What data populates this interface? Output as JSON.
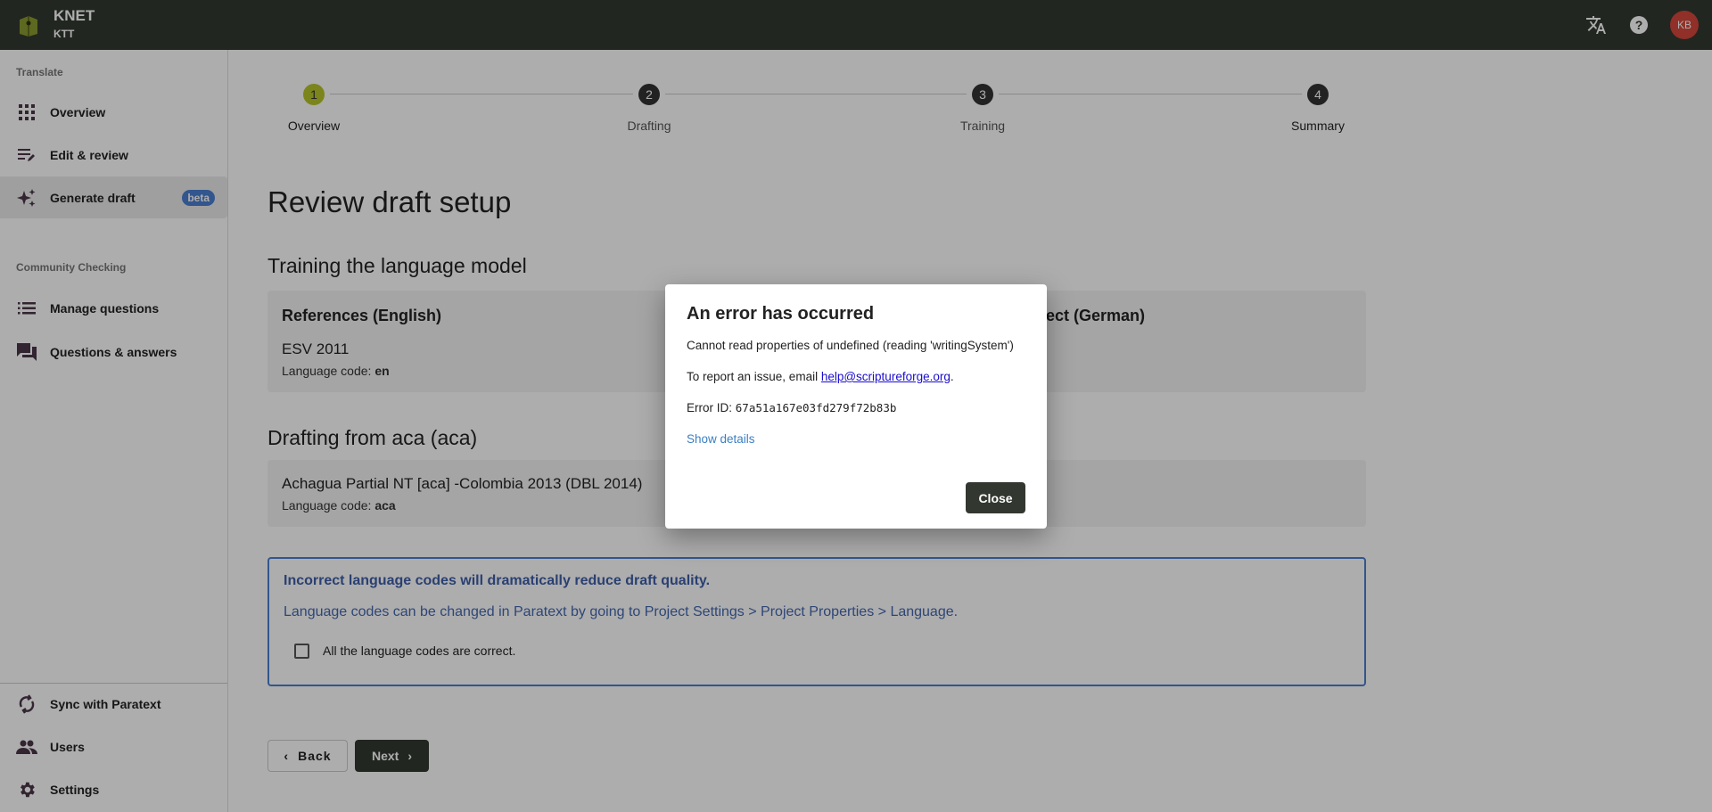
{
  "topbar": {
    "title": "KNET",
    "subtitle": "KTT",
    "avatar_initials": "KB",
    "icons": [
      "translate-icon",
      "help-icon"
    ]
  },
  "sidebar": {
    "sections": [
      {
        "label": "Translate"
      },
      {
        "label": "Community Checking"
      }
    ],
    "items": [
      {
        "label": "Overview",
        "icon": "grid-icon"
      },
      {
        "label": "Edit & review",
        "icon": "edit-list-icon"
      },
      {
        "label": "Generate draft",
        "icon": "sparkle-icon",
        "badge": "beta",
        "active": true
      },
      {
        "label": "Manage questions",
        "icon": "list-icon"
      },
      {
        "label": "Questions & answers",
        "icon": "forum-icon"
      },
      {
        "label": "Sync with Paratext",
        "icon": "sync-icon"
      },
      {
        "label": "Users",
        "icon": "users-icon"
      },
      {
        "label": "Settings",
        "icon": "gear-icon"
      }
    ]
  },
  "stepper": {
    "current": 1,
    "steps": [
      {
        "num": "1",
        "label": "Overview"
      },
      {
        "num": "2",
        "label": "Drafting"
      },
      {
        "num": "3",
        "label": "Training"
      },
      {
        "num": "4",
        "label": "Summary"
      }
    ]
  },
  "main": {
    "title": "Review draft setup",
    "training_heading": "Training the language model",
    "references_title": "References (English)",
    "references_name": "ESV 2011",
    "lang_code_label": "Language code: ",
    "references_code": "en",
    "target_title": "ect (German)",
    "drafting_heading": "Drafting from aca (aca)",
    "drafting_name": "Achagua Partial NT [aca] -Colombia 2013 (DBL 2014)",
    "drafting_code": "aca",
    "notice_title": "Incorrect language codes will dramatically reduce draft quality.",
    "notice_text": "Language codes can be changed in Paratext by going to Project Settings > Project Properties > Language.",
    "checkbox_label": "All the language codes are correct.",
    "checkbox_checked": false,
    "back_label": "Back",
    "next_label": "Next"
  },
  "dialog": {
    "title": "An error has occurred",
    "message": "Cannot read properties of undefined (reading 'writingSystem')",
    "report_prefix": "To report an issue, email ",
    "report_email": "help@scriptureforge.org",
    "report_suffix": ".",
    "error_id_label": "Error ID: ",
    "error_id": "67a51a167e03fd279f72b83b",
    "show_details": "Show details",
    "close_label": "Close"
  },
  "colors": {
    "topbar": "#323830",
    "accent": "#b5c42a",
    "notice_blue": "#4a7fd0",
    "avatar": "#d4483c"
  }
}
